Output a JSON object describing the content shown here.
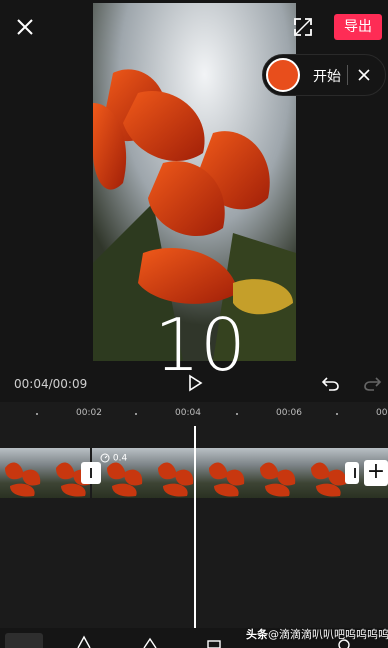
{
  "header": {
    "export_label": "导出",
    "close_icon": "close-icon",
    "fullscreen_icon": "fullscreen-icon"
  },
  "record": {
    "start_label": "开始",
    "dot_color": "#e84e1c"
  },
  "preview": {
    "countdown": "10"
  },
  "playback": {
    "time": "00:04/00:09"
  },
  "timeline": {
    "ruler_labels": [
      "00:02",
      "00:04",
      "00:06",
      "00:0"
    ],
    "speed_badge": "0.4",
    "add_label": "+"
  },
  "watermark": {
    "prefix": "头条",
    "text": "@滴滴滴叭叭吧呜呜呜呜"
  },
  "colors": {
    "accent": "#fe2c55",
    "background": "#151515"
  }
}
